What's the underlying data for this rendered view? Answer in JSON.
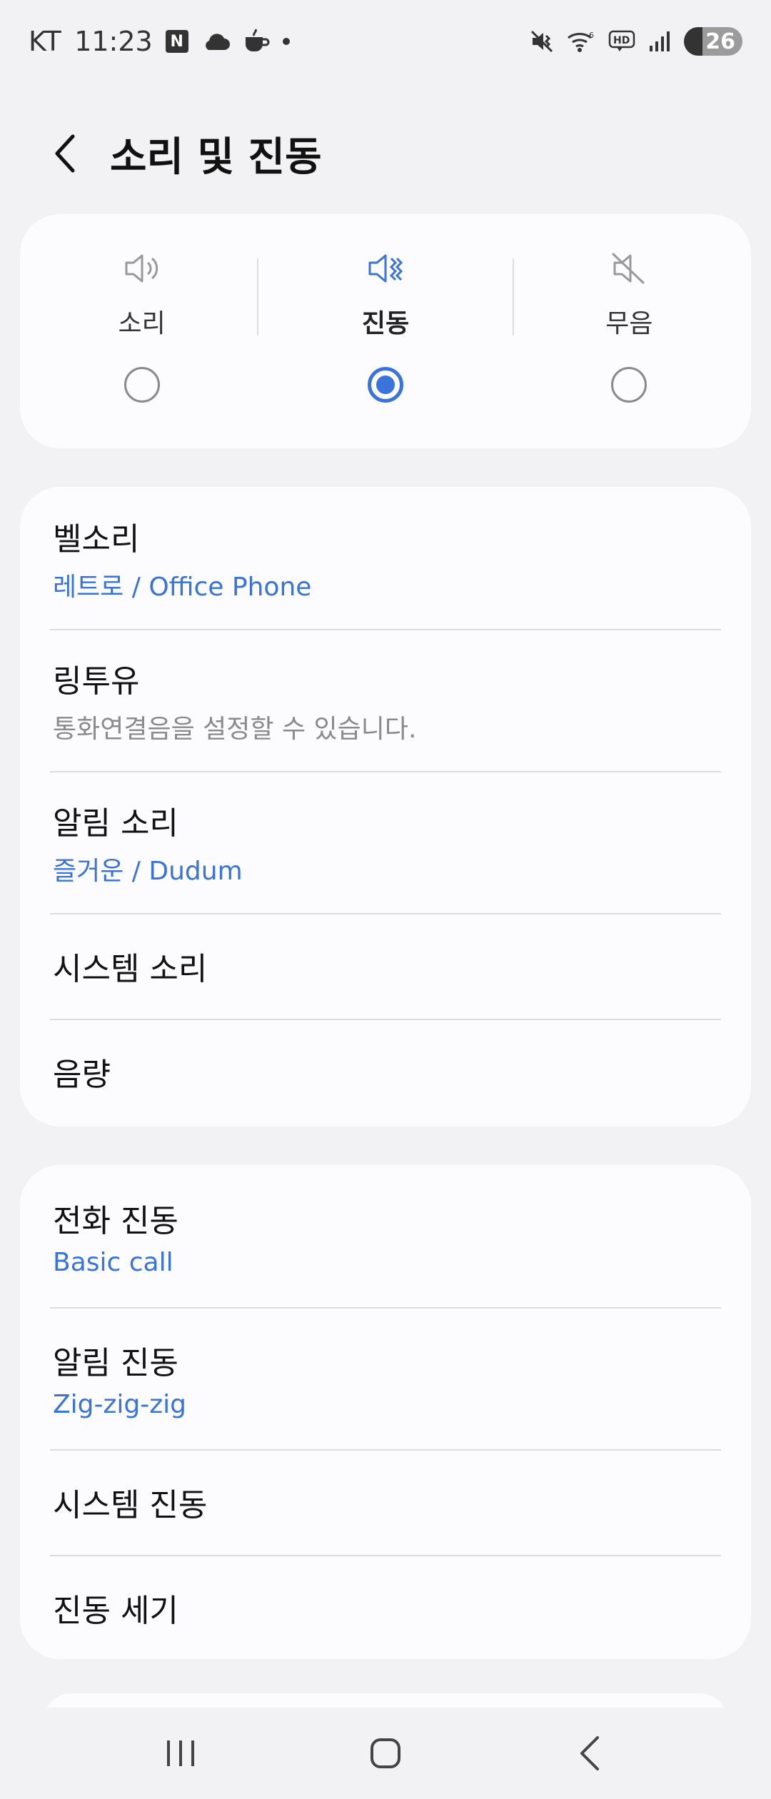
{
  "status_bar": {
    "carrier": "KT",
    "time": "11:23",
    "battery": "26",
    "left_icons": [
      "naver-n-icon",
      "cloud-icon",
      "coffee-icon",
      "dot-icon"
    ],
    "right_icons": [
      "vibrate-mute-icon",
      "wifi-icon",
      "hd-icon",
      "signal-icon",
      "battery-icon"
    ]
  },
  "header": {
    "title": "소리 및 진동"
  },
  "modes": [
    {
      "label": "소리",
      "icon": "speaker-icon",
      "selected": false
    },
    {
      "label": "진동",
      "icon": "vibrate-icon",
      "selected": true
    },
    {
      "label": "무음",
      "icon": "mute-icon",
      "selected": false
    }
  ],
  "sound_group": [
    {
      "title": "벨소리",
      "subtitle": "레트로 / Office Phone"
    },
    {
      "title": "링투유",
      "subtitle": "통화연결음을 설정할 수 있습니다."
    },
    {
      "title": "알림 소리",
      "subtitle": "즐거운 / Dudum"
    },
    {
      "title": "시스템 소리"
    },
    {
      "title": "음량"
    }
  ],
  "vibration_group": [
    {
      "title": "전화 진동",
      "subtitle": "Basic call"
    },
    {
      "title": "알림 진동",
      "subtitle": "Zig-zig-zig"
    },
    {
      "title": "시스템 진동"
    },
    {
      "title": "진동 세기"
    }
  ],
  "colors": {
    "accent": "#3a73d9",
    "background": "#f2f2f4",
    "card": "#fcfcfe"
  }
}
